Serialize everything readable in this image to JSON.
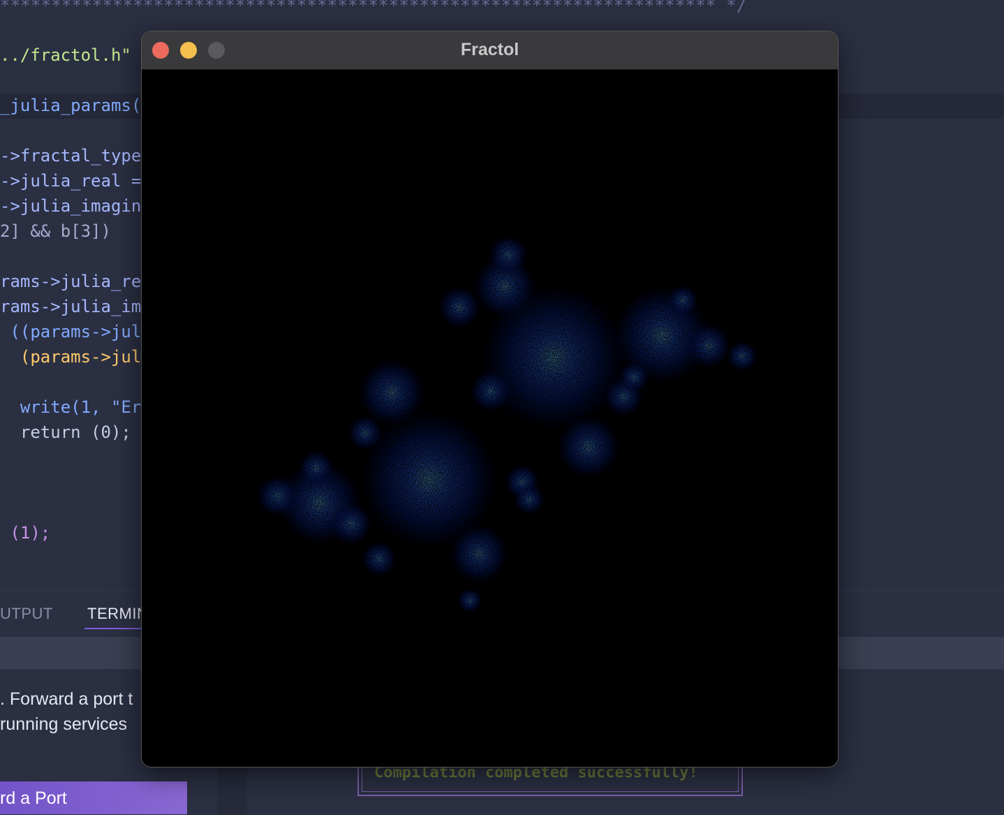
{
  "editor": {
    "comment_line": "**********************************************************************  */",
    "lines": [
      {
        "text": "../fractol.h\""
      },
      {
        "text": "_julia_params("
      },
      {
        "text": "->fractal_type"
      },
      {
        "text": "->julia_real ="
      },
      {
        "text": "->julia_imagin"
      },
      {
        "text": "2] && b[3])"
      },
      {
        "text": "rams->julia_re"
      },
      {
        "text": "rams->julia_im"
      },
      {
        "text": " ((params->jul"
      },
      {
        "text": "  (params->jul"
      },
      {
        "text": "  write(1, \"Er"
      },
      {
        "text": "  return (0);"
      },
      {
        "text": " (1);"
      }
    ]
  },
  "panel": {
    "tabs": [
      {
        "label": "UTPUT"
      },
      {
        "label": "TERMIN"
      }
    ],
    "message_line1": ". Forward a port t",
    "message_line2": "running services",
    "forward_button": "rd a Port",
    "compile_message": "Compilation completed successfully!"
  },
  "window": {
    "title": "Fractol"
  },
  "colors": {
    "fractal_core": "#1a4fff",
    "fractal_glow": "#4aa8ff",
    "close": "#ed6a5e",
    "minimize": "#f5bf4f"
  }
}
